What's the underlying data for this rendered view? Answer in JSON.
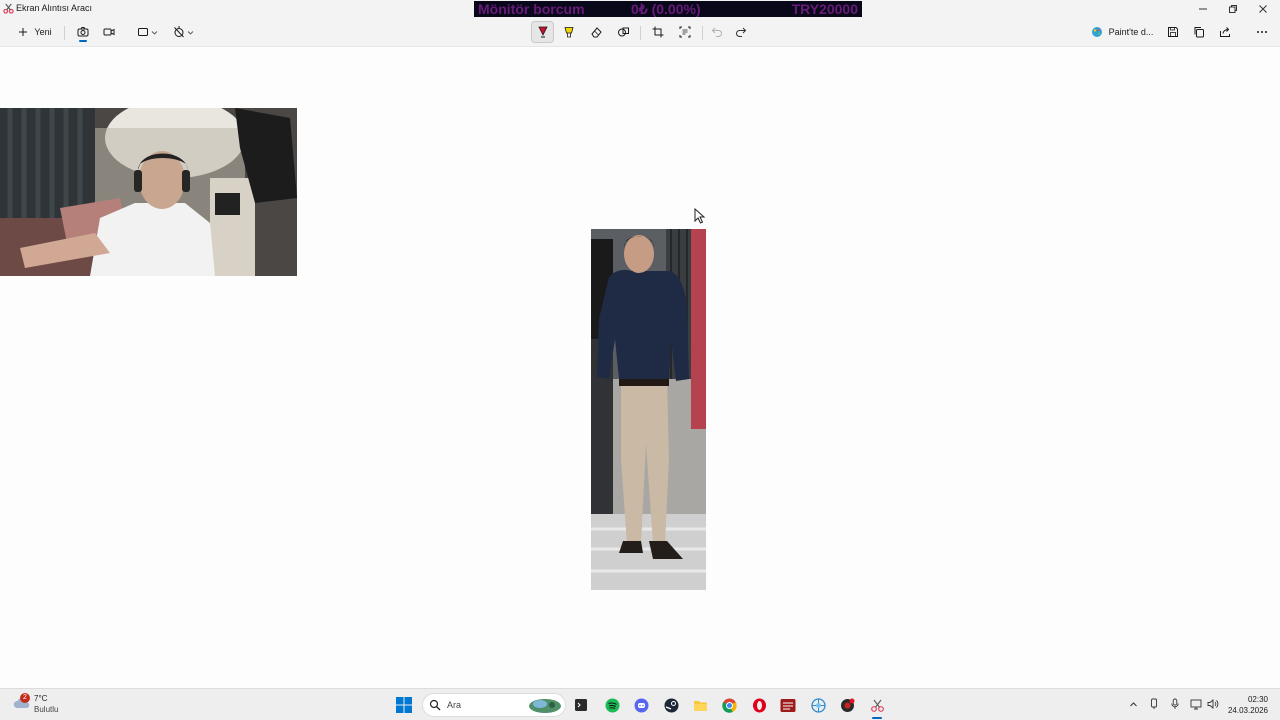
{
  "window": {
    "title": "Ekran Alıntısı Aracı"
  },
  "stream_overlay": {
    "label": "Mönitör borcum",
    "progress_text": "0₺ (0.00%)",
    "goal": "TRY20000",
    "progress_percent": 0
  },
  "toolbar": {
    "new_label": "Yeni",
    "paint_label": "Paint'te d..."
  },
  "taskbar": {
    "weather": {
      "badge": "2",
      "temp": "7°C",
      "condition": "Bulutlu"
    },
    "search_placeholder": "Ara",
    "time": "02:30",
    "date": "24.03.2026"
  },
  "colors": {
    "accent": "#0067c0",
    "overlay_bg": "#08081a",
    "overlay_text": "#6a1a7a"
  }
}
